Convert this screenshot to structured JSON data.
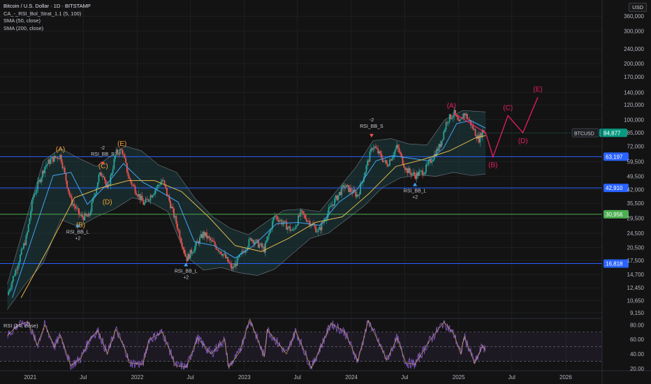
{
  "header": {
    "title": "Bitcoin / U.S. Dollar · 1D · BITSTAMP",
    "indicators": [
      "CA_-_RSI_Bol_Strat_1.1 (5, 100)",
      "SMA (50, close)",
      "SMA (200, close)"
    ],
    "currency": "USD",
    "rsi_label": "RSI (14, close)"
  },
  "colors": {
    "background": "#131313",
    "up_candle": "#26a69a",
    "down_candle": "#ef5350",
    "sma50": "#42a5f5",
    "sma200": "#e2b74a",
    "bollinger_fill": "#1e3c3f",
    "hline_blue": "#2962ff",
    "hline_green": "#4caf50",
    "wave_orange": "#f0a030",
    "wave_pink": "#e91e63",
    "rsi_line": "#7e57c2",
    "price_tag": "#089981"
  },
  "chart_data": {
    "type": "line",
    "y_scale": "log",
    "price_axis_ticks": [
      360000,
      300000,
      240000,
      200000,
      170000,
      140000,
      120000,
      100000,
      85000,
      72000,
      59500,
      49500,
      42000,
      35500,
      29500,
      24500,
      20500,
      17500,
      14700,
      12450,
      10650,
      9150
    ],
    "x_ticks": [
      {
        "label": "2021",
        "date": "2021-01-01"
      },
      {
        "label": "Jul",
        "date": "2021-07-01"
      },
      {
        "label": "2022",
        "date": "2022-01-01"
      },
      {
        "label": "Jul",
        "date": "2022-07-01"
      },
      {
        "label": "2023",
        "date": "2023-01-01"
      },
      {
        "label": "Jul",
        "date": "2023-07-01"
      },
      {
        "label": "2024",
        "date": "2024-01-01"
      },
      {
        "label": "Jul",
        "date": "2024-07-01"
      },
      {
        "label": "2025",
        "date": "2025-01-01"
      },
      {
        "label": "Jul",
        "date": "2025-07-01"
      },
      {
        "label": "2026",
        "date": "2026-01-01"
      }
    ],
    "price_path": [
      [
        "2020-10-15",
        11400
      ],
      [
        "2020-11-15",
        16000
      ],
      [
        "2020-12-20",
        23500
      ],
      [
        "2021-01-10",
        38000
      ],
      [
        "2021-02-20",
        56000
      ],
      [
        "2021-03-13",
        61000
      ],
      [
        "2021-04-14",
        64000
      ],
      [
        "2021-05-19",
        37000
      ],
      [
        "2021-06-22",
        30000
      ],
      [
        "2021-07-20",
        30000
      ],
      [
        "2021-08-23",
        49500
      ],
      [
        "2021-09-07",
        52000
      ],
      [
        "2021-09-21",
        41000
      ],
      [
        "2021-10-20",
        66000
      ],
      [
        "2021-11-10",
        68500
      ],
      [
        "2021-12-04",
        48000
      ],
      [
        "2022-01-24",
        35000
      ],
      [
        "2022-03-28",
        47500
      ],
      [
        "2022-05-12",
        28500
      ],
      [
        "2022-06-18",
        17800
      ],
      [
        "2022-08-15",
        24400
      ],
      [
        "2022-10-20",
        19000
      ],
      [
        "2022-11-21",
        15700
      ],
      [
        "2023-01-25",
        23000
      ],
      [
        "2023-03-10",
        20000
      ],
      [
        "2023-04-14",
        30500
      ],
      [
        "2023-06-15",
        25000
      ],
      [
        "2023-07-13",
        31500
      ],
      [
        "2023-09-11",
        25000
      ],
      [
        "2023-10-25",
        34500
      ],
      [
        "2023-12-08",
        44000
      ],
      [
        "2024-01-23",
        39000
      ],
      [
        "2024-03-14",
        73000
      ],
      [
        "2024-05-01",
        57000
      ],
      [
        "2024-06-05",
        71500
      ],
      [
        "2024-07-05",
        54000
      ],
      [
        "2024-08-05",
        50000
      ],
      [
        "2024-09-06",
        53000
      ],
      [
        "2024-10-29",
        72500
      ],
      [
        "2024-11-22",
        99500
      ],
      [
        "2024-12-17",
        108000
      ],
      [
        "2025-01-02",
        94000
      ],
      [
        "2025-01-20",
        109000
      ],
      [
        "2025-02-10",
        96000
      ],
      [
        "2025-03-10",
        78000
      ],
      [
        "2025-03-24",
        87500
      ],
      [
        "2025-04-03",
        84877
      ]
    ],
    "sma50_path": [
      [
        "2020-11-01",
        11000
      ],
      [
        "2021-01-15",
        25000
      ],
      [
        "2021-03-20",
        50000
      ],
      [
        "2021-05-20",
        52000
      ],
      [
        "2021-07-15",
        35000
      ],
      [
        "2021-09-15",
        44000
      ],
      [
        "2021-11-15",
        58000
      ],
      [
        "2022-01-20",
        46000
      ],
      [
        "2022-03-20",
        41000
      ],
      [
        "2022-05-20",
        36000
      ],
      [
        "2022-07-15",
        22000
      ],
      [
        "2022-09-20",
        21000
      ],
      [
        "2022-12-01",
        18000
      ],
      [
        "2023-02-01",
        21000
      ],
      [
        "2023-04-20",
        27500
      ],
      [
        "2023-07-01",
        28000
      ],
      [
        "2023-09-15",
        27000
      ],
      [
        "2023-11-20",
        36000
      ],
      [
        "2024-01-20",
        42000
      ],
      [
        "2024-03-25",
        60000
      ],
      [
        "2024-05-20",
        64000
      ],
      [
        "2024-07-20",
        62000
      ],
      [
        "2024-09-20",
        60000
      ],
      [
        "2024-11-10",
        70000
      ],
      [
        "2024-12-25",
        95000
      ],
      [
        "2025-02-10",
        99000
      ],
      [
        "2025-04-03",
        90000
      ]
    ],
    "sma200_path": [
      [
        "2020-12-01",
        11000
      ],
      [
        "2021-03-01",
        20000
      ],
      [
        "2021-06-01",
        38000
      ],
      [
        "2021-09-01",
        43000
      ],
      [
        "2021-12-01",
        47000
      ],
      [
        "2022-03-01",
        47000
      ],
      [
        "2022-06-01",
        41000
      ],
      [
        "2022-09-01",
        30000
      ],
      [
        "2022-12-01",
        21000
      ],
      [
        "2023-03-01",
        19500
      ],
      [
        "2023-06-01",
        23000
      ],
      [
        "2023-09-01",
        28000
      ],
      [
        "2023-12-01",
        30000
      ],
      [
        "2024-03-01",
        40000
      ],
      [
        "2024-06-01",
        56000
      ],
      [
        "2024-09-01",
        61000
      ],
      [
        "2024-12-01",
        68000
      ],
      [
        "2025-03-01",
        80000
      ],
      [
        "2025-04-03",
        82000
      ]
    ],
    "bollinger_upper": [
      [
        "2020-10-15",
        13000
      ],
      [
        "2020-12-15",
        28000
      ],
      [
        "2021-02-15",
        60000
      ],
      [
        "2021-04-15",
        70000
      ],
      [
        "2021-06-15",
        62000
      ],
      [
        "2021-08-15",
        56000
      ],
      [
        "2021-10-15",
        66000
      ],
      [
        "2021-11-20",
        72000
      ],
      [
        "2022-01-15",
        68000
      ],
      [
        "2022-03-15",
        57000
      ],
      [
        "2022-05-15",
        52000
      ],
      [
        "2022-07-15",
        38000
      ],
      [
        "2022-09-15",
        30000
      ],
      [
        "2022-11-15",
        26000
      ],
      [
        "2023-01-15",
        24000
      ],
      [
        "2023-03-15",
        28000
      ],
      [
        "2023-05-15",
        32500
      ],
      [
        "2023-07-15",
        33000
      ],
      [
        "2023-09-15",
        32000
      ],
      [
        "2023-11-15",
        42000
      ],
      [
        "2024-01-15",
        55000
      ],
      [
        "2024-03-15",
        77000
      ],
      [
        "2024-05-15",
        79000
      ],
      [
        "2024-07-15",
        74000
      ],
      [
        "2024-09-15",
        73000
      ],
      [
        "2024-11-15",
        100000
      ],
      [
        "2025-01-15",
        112000
      ],
      [
        "2025-04-03",
        110000
      ]
    ],
    "bollinger_lower": [
      [
        "2020-10-15",
        9500
      ],
      [
        "2020-12-15",
        13000
      ],
      [
        "2021-02-15",
        17000
      ],
      [
        "2021-04-15",
        29000
      ],
      [
        "2021-06-15",
        26500
      ],
      [
        "2021-08-15",
        30000
      ],
      [
        "2021-10-15",
        33000
      ],
      [
        "2021-12-15",
        38000
      ],
      [
        "2022-02-15",
        36000
      ],
      [
        "2022-04-15",
        32000
      ],
      [
        "2022-06-15",
        18500
      ],
      [
        "2022-08-15",
        15500
      ],
      [
        "2022-10-15",
        16000
      ],
      [
        "2022-12-15",
        15000
      ],
      [
        "2023-02-15",
        14500
      ],
      [
        "2023-04-15",
        15700
      ],
      [
        "2023-06-15",
        19000
      ],
      [
        "2023-08-15",
        23000
      ],
      [
        "2023-10-15",
        24500
      ],
      [
        "2023-12-15",
        29000
      ],
      [
        "2024-02-15",
        34500
      ],
      [
        "2024-04-15",
        43000
      ],
      [
        "2024-06-15",
        48500
      ],
      [
        "2024-08-15",
        50500
      ],
      [
        "2024-10-15",
        49500
      ],
      [
        "2024-12-15",
        52000
      ],
      [
        "2025-02-15",
        50000
      ],
      [
        "2025-04-03",
        51000
      ]
    ],
    "horizontal_levels": [
      {
        "label": "63,197",
        "value": 63197,
        "color": "#2962ff"
      },
      {
        "label": "42,910",
        "value": 42910,
        "color": "#2962ff"
      },
      {
        "label": "30,956",
        "value": 30956,
        "color": "#4caf50"
      },
      {
        "label": "16,818",
        "value": 16818,
        "color": "#2962ff"
      }
    ],
    "last_price": {
      "symbol": "BTCUSD",
      "label": "84,877",
      "value": 84877
    },
    "wave_2021": [
      {
        "label": "(A)",
        "date": "2021-04-14",
        "value": 64000
      },
      {
        "label": "(B)",
        "date": "2021-06-22",
        "value": 30000
      },
      {
        "label": "(C)",
        "date": "2021-09-07",
        "value": 52000
      },
      {
        "label": "(D)",
        "date": "2021-09-21",
        "value": 40000
      },
      {
        "label": "(E)",
        "date": "2021-11-10",
        "value": 68500
      }
    ],
    "wave_2025_projection": [
      {
        "label": "(A)",
        "date": "2024-12-17",
        "value": 108000
      },
      {
        "date": "2025-04-03",
        "value": 84877
      },
      {
        "label": "(B)",
        "date": "2025-04-28",
        "value": 63000
      },
      {
        "label": "(C)",
        "date": "2025-06-18",
        "value": 105000
      },
      {
        "label": "(D)",
        "date": "2025-08-08",
        "value": 85000
      },
      {
        "label": "(E)",
        "date": "2025-09-28",
        "value": 132000
      }
    ],
    "signals": [
      {
        "text": "RSI_BB_L",
        "sub": "+2",
        "date": "2021-06-12",
        "value": 30000,
        "kind": "long"
      },
      {
        "text": "RSI_BB_S",
        "sub": "-2",
        "date": "2021-09-05",
        "value": 52000,
        "kind": "short"
      },
      {
        "text": "RSI_BB_L",
        "sub": "+2",
        "date": "2022-06-16",
        "value": 18500,
        "kind": "long"
      },
      {
        "text": "RSI_BB_S",
        "sub": "-2",
        "date": "2024-03-10",
        "value": 73500,
        "kind": "short"
      },
      {
        "text": "RSI_BB_L",
        "sub": "+2",
        "date": "2024-08-05",
        "value": 50000,
        "kind": "long"
      }
    ],
    "rsi": {
      "ylim": [
        18,
        87
      ],
      "ticks": [
        80,
        60,
        40,
        20
      ],
      "tick_labels": [
        "80.00",
        "60.00",
        "40.00",
        "20.00"
      ],
      "band": [
        30,
        70
      ],
      "path": [
        [
          "2020-10-15",
          65
        ],
        [
          "2020-11-20",
          80
        ],
        [
          "2020-12-25",
          84
        ],
        [
          "2021-01-25",
          52
        ],
        [
          "2021-02-20",
          80
        ],
        [
          "2021-03-25",
          50
        ],
        [
          "2021-04-14",
          66
        ],
        [
          "2021-05-19",
          24
        ],
        [
          "2021-06-22",
          34
        ],
        [
          "2021-07-25",
          62
        ],
        [
          "2021-08-20",
          72
        ],
        [
          "2021-09-21",
          40
        ],
        [
          "2021-10-20",
          74
        ],
        [
          "2021-11-25",
          42
        ],
        [
          "2021-12-04",
          28
        ],
        [
          "2022-01-20",
          26
        ],
        [
          "2022-02-10",
          60
        ],
        [
          "2022-03-28",
          70
        ],
        [
          "2022-05-12",
          24
        ],
        [
          "2022-06-18",
          22
        ],
        [
          "2022-07-25",
          62
        ],
        [
          "2022-09-10",
          40
        ],
        [
          "2022-10-25",
          60
        ],
        [
          "2022-11-09",
          22
        ],
        [
          "2022-12-15",
          42
        ],
        [
          "2023-01-20",
          88
        ],
        [
          "2023-03-10",
          36
        ],
        [
          "2023-03-20",
          74
        ],
        [
          "2023-05-25",
          40
        ],
        [
          "2023-06-25",
          72
        ],
        [
          "2023-08-18",
          21
        ],
        [
          "2023-10-24",
          82
        ],
        [
          "2023-12-10",
          70
        ],
        [
          "2024-01-23",
          30
        ],
        [
          "2024-02-28",
          86
        ],
        [
          "2024-05-01",
          32
        ],
        [
          "2024-06-05",
          62
        ],
        [
          "2024-07-05",
          28
        ],
        [
          "2024-08-05",
          26
        ],
        [
          "2024-09-20",
          56
        ],
        [
          "2024-11-12",
          84
        ],
        [
          "2024-12-17",
          66
        ],
        [
          "2025-01-08",
          40
        ],
        [
          "2025-01-20",
          64
        ],
        [
          "2025-02-25",
          27
        ],
        [
          "2025-03-24",
          52
        ],
        [
          "2025-04-03",
          44
        ]
      ]
    }
  }
}
